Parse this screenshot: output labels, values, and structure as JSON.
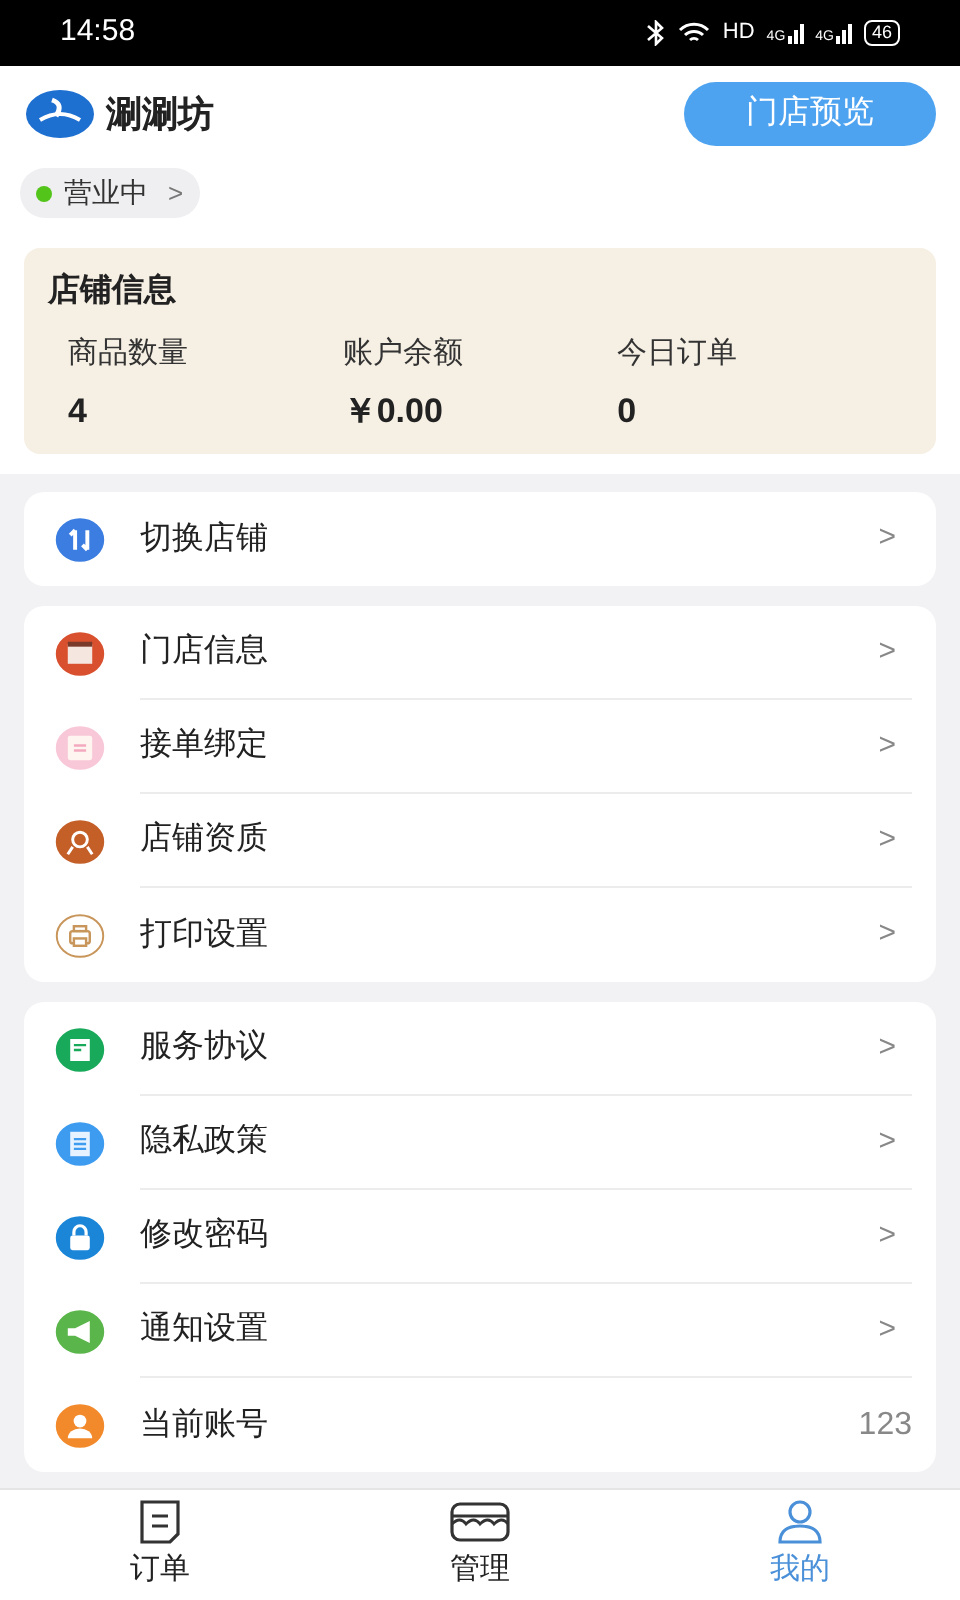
{
  "status_bar": {
    "time": "14:58",
    "network": "HD",
    "signal_1": "4G",
    "signal_2": "4G",
    "battery": "46"
  },
  "header": {
    "app_name": "涮涮坊",
    "preview_button": "门店预览"
  },
  "business_status": {
    "label": "营业中",
    "open": true,
    "chevron": ">"
  },
  "store_info": {
    "title": "店铺信息",
    "stats": [
      {
        "label": "商品数量",
        "value": "4"
      },
      {
        "label": "账户余额",
        "value": "￥0.00"
      },
      {
        "label": "今日订单",
        "value": "0"
      }
    ]
  },
  "menu_groups": [
    {
      "items": [
        {
          "kind": "swap",
          "label": "切换店铺",
          "color": "#3b7de0",
          "chevron": ">"
        }
      ]
    },
    {
      "items": [
        {
          "kind": "calendar",
          "label": "门店信息",
          "color": "#d9502e",
          "chevron": ">"
        },
        {
          "kind": "note",
          "label": "接单绑定",
          "color": "#f8c7d8",
          "chevron": ">"
        },
        {
          "kind": "badge",
          "label": "店铺资质",
          "color": "#c45f28",
          "chevron": ">"
        },
        {
          "kind": "printer",
          "label": "打印设置",
          "color": "#c8955a",
          "chevron": ">"
        }
      ]
    },
    {
      "items": [
        {
          "kind": "document",
          "label": "服务协议",
          "color": "#19a95a",
          "chevron": ">"
        },
        {
          "kind": "page",
          "label": "隐私政策",
          "color": "#3d9bf0",
          "chevron": ">"
        },
        {
          "kind": "lock",
          "label": "修改密码",
          "color": "#1b86d8",
          "chevron": ">"
        },
        {
          "kind": "megaphone",
          "label": "通知设置",
          "color": "#5ab54a",
          "chevron": ">"
        },
        {
          "kind": "person",
          "label": "当前账号",
          "color": "#f28a2c",
          "value": "123"
        }
      ]
    }
  ],
  "bottom_nav": [
    {
      "kind": "orders",
      "label": "订单",
      "selected": false
    },
    {
      "kind": "store",
      "label": "管理",
      "selected": false
    },
    {
      "kind": "person",
      "label": "我的",
      "selected": true
    }
  ]
}
